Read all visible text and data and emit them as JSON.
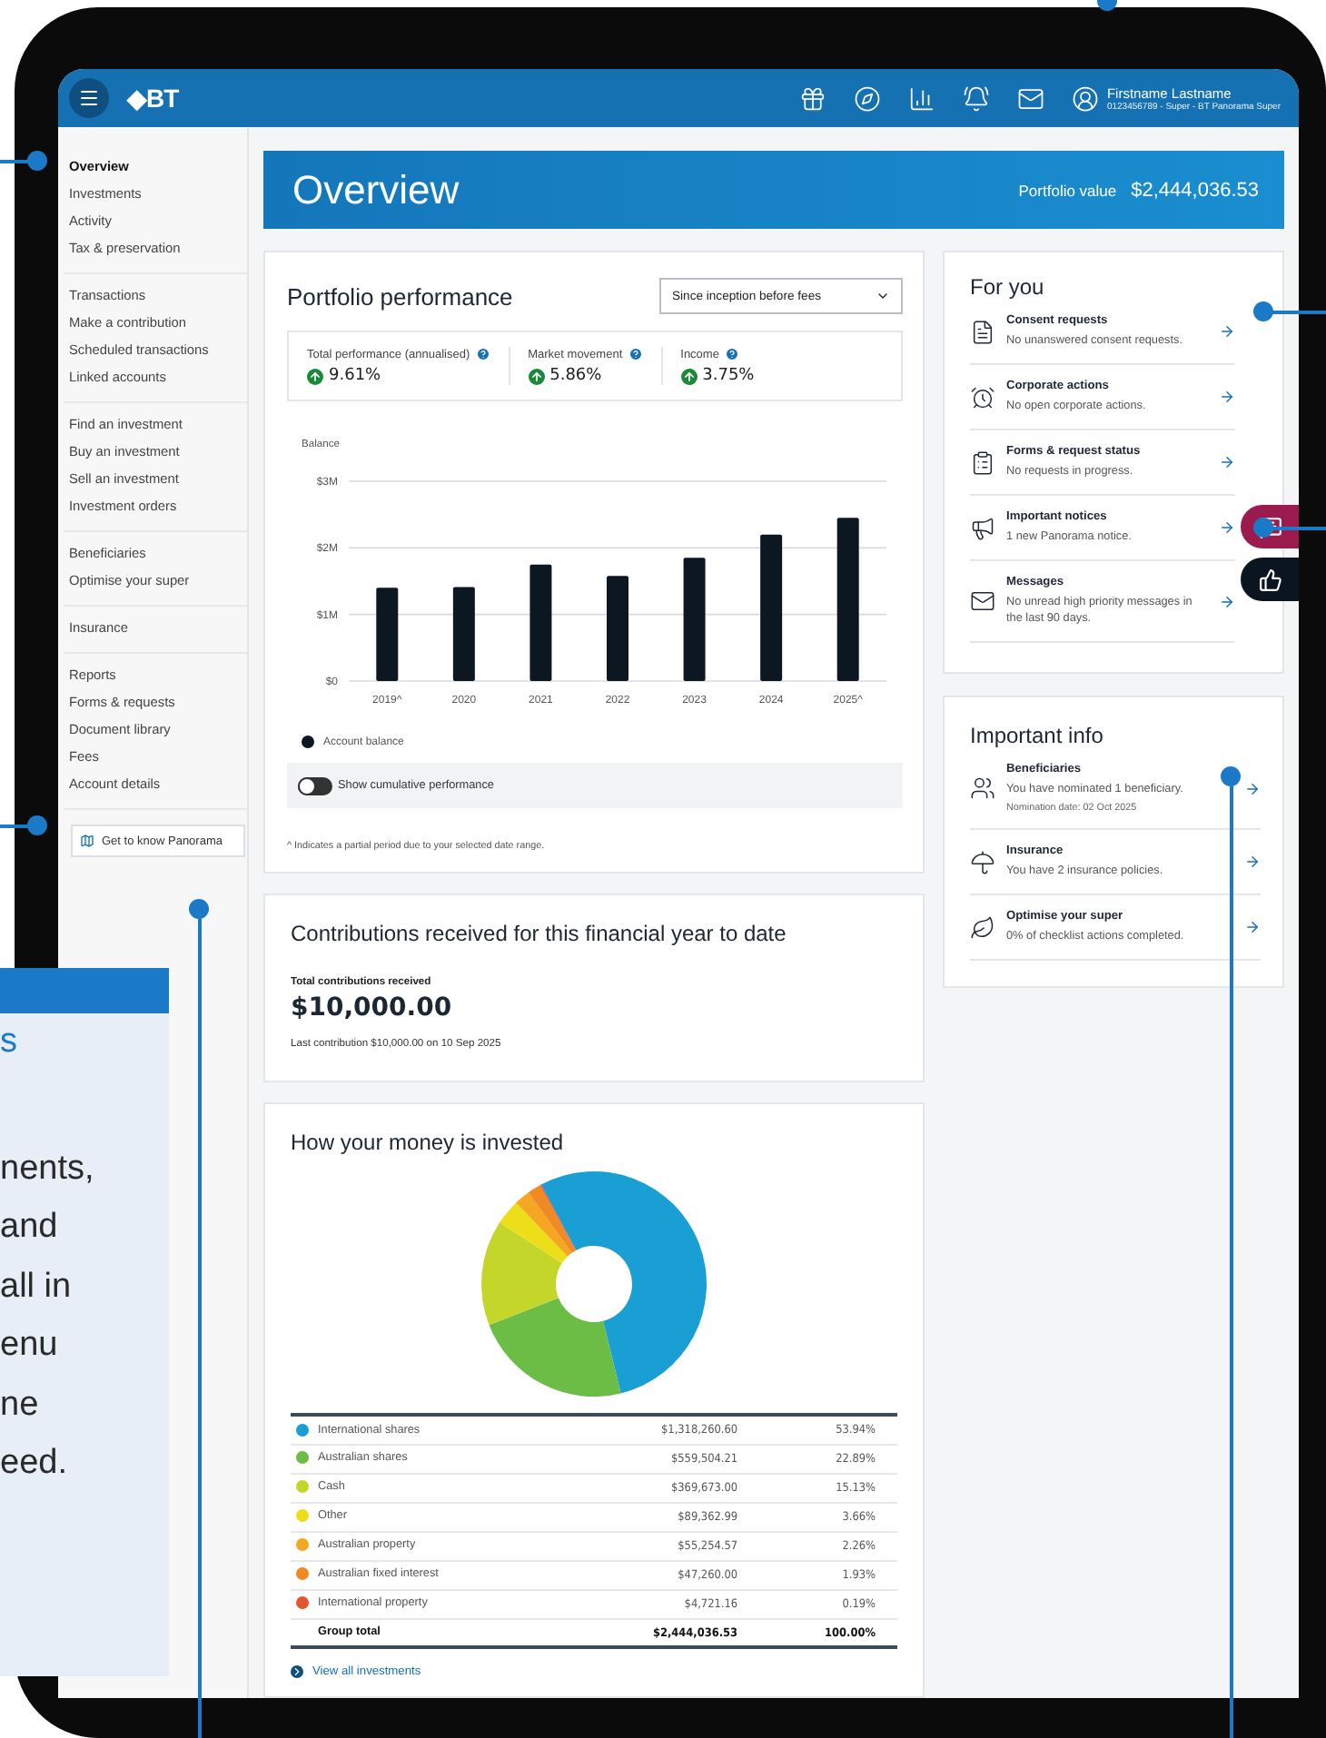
{
  "header": {
    "logo": "◆BT",
    "user_name": "Firstname Lastname",
    "user_account": "0123456789 - Super - BT Panorama Super"
  },
  "sidebar": {
    "groups": [
      {
        "items": [
          {
            "label": "Overview",
            "selected": true
          },
          {
            "label": "Investments",
            "selected": false
          },
          {
            "label": "Activity",
            "selected": false
          },
          {
            "label": "Tax & preservation",
            "selected": false
          }
        ]
      },
      {
        "items": [
          {
            "label": "Transactions",
            "selected": false
          },
          {
            "label": "Make a contribution",
            "selected": false
          },
          {
            "label": "Scheduled transactions",
            "selected": false
          },
          {
            "label": "Linked accounts",
            "selected": false
          }
        ]
      },
      {
        "items": [
          {
            "label": "Find an investment",
            "selected": false
          },
          {
            "label": "Buy an investment",
            "selected": false
          },
          {
            "label": "Sell an investment",
            "selected": false
          },
          {
            "label": "Investment orders",
            "selected": false
          }
        ]
      },
      {
        "items": [
          {
            "label": "Beneficiaries",
            "selected": false
          },
          {
            "label": "Optimise your super",
            "selected": false
          }
        ]
      },
      {
        "items": [
          {
            "label": "Insurance",
            "selected": false
          }
        ]
      },
      {
        "items": [
          {
            "label": "Reports",
            "selected": false
          },
          {
            "label": "Forms & requests",
            "selected": false
          },
          {
            "label": "Document library",
            "selected": false
          },
          {
            "label": "Fees",
            "selected": false
          },
          {
            "label": "Account details",
            "selected": false
          }
        ]
      }
    ],
    "button": "Get to know Panorama"
  },
  "banner": {
    "title": "Overview",
    "value_label": "Portfolio value",
    "value": "$2,444,036.53"
  },
  "performance": {
    "title": "Portfolio performance",
    "period": "Since inception before fees",
    "metrics": [
      {
        "label": "Total performance (annualised)",
        "value": "9.61%"
      },
      {
        "label": "Market movement",
        "value": "5.86%"
      },
      {
        "label": "Income",
        "value": "3.75%"
      }
    ],
    "chart_data": {
      "type": "bar",
      "ylabel": "Balance",
      "categories": [
        "2019^",
        "2020",
        "2021",
        "2022",
        "2023",
        "2024",
        "2025^"
      ],
      "series": [
        {
          "name": "Account balance",
          "color": "#0d1722",
          "values": [
            1.4,
            1.41,
            1.75,
            1.58,
            1.85,
            2.2,
            2.45
          ]
        }
      ],
      "ylim": [
        0,
        3
      ],
      "yticks": [
        {
          "value": 0,
          "label": "$0"
        },
        {
          "value": 1,
          "label": "$1M"
        },
        {
          "value": 2,
          "label": "$2M"
        },
        {
          "value": 3,
          "label": "$3M"
        }
      ]
    },
    "toggle": {
      "label": "Show cumulative performance",
      "on": false
    },
    "footnote": "^ Indicates a partial period due to your selected date range."
  },
  "contributions": {
    "title": "Contributions received for this financial year to date",
    "label": "Total contributions received",
    "amount": "$10,000.00",
    "last": "Last contribution $10,000.00 on 10 Sep 2025"
  },
  "investments": {
    "title": "How your money is invested",
    "chart_data": {
      "type": "donut",
      "categories": [
        "International shares",
        "Australian shares",
        "Cash",
        "Other",
        "Australian property",
        "Australian fixed interest",
        "International property"
      ],
      "values": [
        53.94,
        22.89,
        15.13,
        3.66,
        2.26,
        1.93,
        0.19
      ]
    },
    "rows": [
      {
        "amount": "$1,318,260.60",
        "percent": "53.94%",
        "color": "#1a9fd4"
      },
      {
        "amount": "$559,504.21",
        "percent": "22.89%",
        "color": "#6cbd45"
      },
      {
        "amount": "$369,673.00",
        "percent": "15.13%",
        "color": "#c5d62a"
      },
      {
        "amount": "$89,362.99",
        "percent": "3.66%",
        "color": "#ecdf1a"
      },
      {
        "amount": "$55,254.57",
        "percent": "2.26%",
        "color": "#f5a623"
      },
      {
        "amount": "$47,260.00",
        "percent": "1.93%",
        "color": "#f08a24"
      },
      {
        "amount": "$4,721.16",
        "percent": "0.19%",
        "color": "#e4572e"
      }
    ],
    "total": {
      "name": "Group total",
      "amount": "$2,444,036.53",
      "percent": "100.00%"
    },
    "link": "View all investments"
  },
  "for_you": {
    "title": "For you",
    "items": [
      {
        "title": "Consent requests",
        "text": "No unanswered consent requests."
      },
      {
        "title": "Corporate actions",
        "text": "No open corporate actions."
      },
      {
        "title": "Forms & request status",
        "text": "No requests in progress."
      },
      {
        "title": "Important notices",
        "text": "1 new Panorama notice."
      },
      {
        "title": "Messages",
        "text": "No unread high priority messages in the last 90 days."
      }
    ]
  },
  "important_info": {
    "title": "Important info",
    "items": [
      {
        "title": "Beneficiaries",
        "text": "You have nominated 1 beneficiary.",
        "note": "Nomination date: 02 Oct 2025"
      },
      {
        "title": "Insurance",
        "text": "You have 2 insurance policies."
      },
      {
        "title": "Optimise your super",
        "text": "0% of checklist actions completed."
      }
    ]
  },
  "callout": {
    "lines": [
      "s",
      "nents,",
      "and",
      "all in",
      "enu",
      "ne",
      "eed."
    ]
  }
}
